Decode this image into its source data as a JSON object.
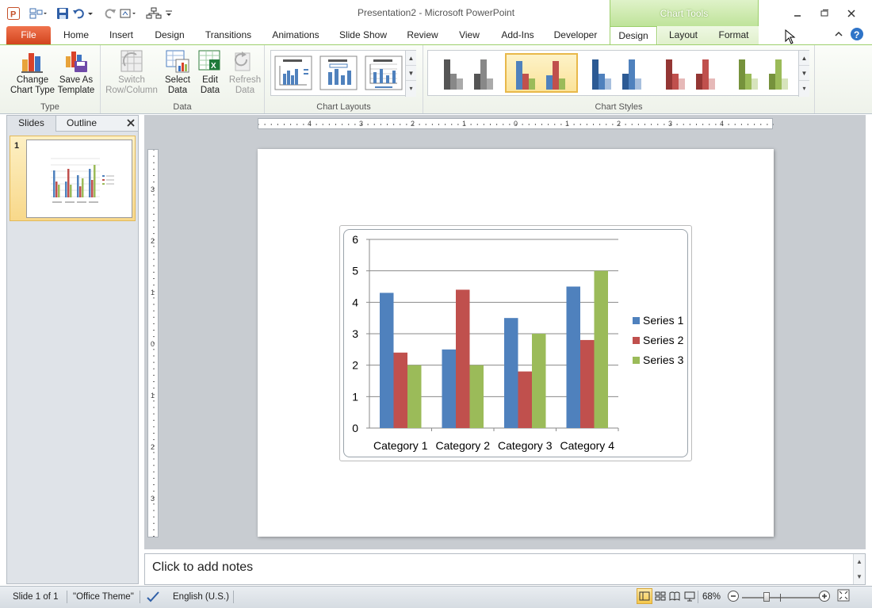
{
  "window": {
    "title": "Presentation2 - Microsoft PowerPoint",
    "context_tab_group": "Chart Tools"
  },
  "tabs": [
    {
      "label": "File"
    },
    {
      "label": "Home"
    },
    {
      "label": "Insert"
    },
    {
      "label": "Design"
    },
    {
      "label": "Transitions"
    },
    {
      "label": "Animations"
    },
    {
      "label": "Slide Show"
    },
    {
      "label": "Review"
    },
    {
      "label": "View"
    },
    {
      "label": "Add-Ins"
    },
    {
      "label": "Developer"
    },
    {
      "label": "Design"
    },
    {
      "label": "Layout"
    },
    {
      "label": "Format"
    }
  ],
  "ribbon": {
    "groups": {
      "type": "Type",
      "data": "Data",
      "layouts": "Chart Layouts",
      "styles": "Chart Styles"
    },
    "buttons": {
      "change_type_1": "Change",
      "change_type_2": "Chart Type",
      "save_template_1": "Save As",
      "save_template_2": "Template",
      "switch_1": "Switch",
      "switch_2": "Row/Column",
      "select_1": "Select",
      "select_2": "Data",
      "edit_1": "Edit",
      "edit_2": "Data",
      "refresh_1": "Refresh",
      "refresh_2": "Data"
    }
  },
  "pane": {
    "tab_slides": "Slides",
    "tab_outline": "Outline",
    "slide_number": "1"
  },
  "notes": {
    "placeholder": "Click to add notes"
  },
  "status": {
    "slide": "Slide 1 of 1",
    "theme": "\"Office Theme\"",
    "language": "English (U.S.)",
    "zoom": "68%"
  },
  "colors": {
    "series1": "#4f81bd",
    "series2": "#c0504d",
    "series3": "#9bbb59",
    "file_tab": "#e2572f",
    "chart_tools": "#9ccf6b"
  },
  "chart_data": {
    "type": "bar",
    "categories": [
      "Category 1",
      "Category 2",
      "Category 3",
      "Category 4"
    ],
    "series": [
      {
        "name": "Series 1",
        "values": [
          4.3,
          2.5,
          3.5,
          4.5
        ]
      },
      {
        "name": "Series 2",
        "values": [
          2.4,
          4.4,
          1.8,
          2.8
        ]
      },
      {
        "name": "Series 3",
        "values": [
          2,
          2,
          3,
          5
        ]
      }
    ],
    "ylim": [
      0,
      6
    ],
    "yticks": [
      "0",
      "1",
      "2",
      "3",
      "4",
      "5",
      "6"
    ],
    "grid": true,
    "legend": "right"
  }
}
